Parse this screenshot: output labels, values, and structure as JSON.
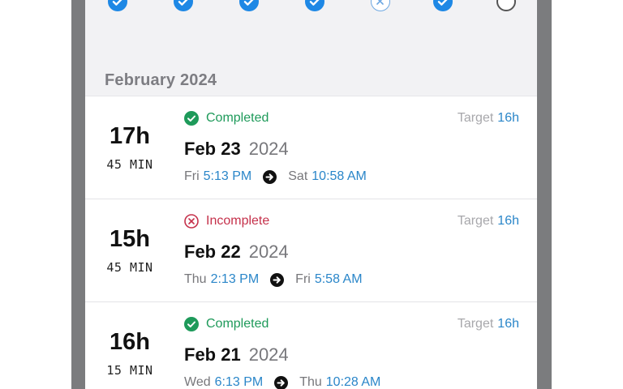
{
  "month_header": "February 2024",
  "week_days": [
    {
      "state": "done",
      "icon": "check-icon"
    },
    {
      "state": "done",
      "icon": "check-icon"
    },
    {
      "state": "done",
      "icon": "check-icon"
    },
    {
      "state": "done",
      "icon": "check-icon"
    },
    {
      "state": "failed",
      "icon": "x-circle-icon"
    },
    {
      "state": "done",
      "icon": "check-icon"
    },
    {
      "state": "pending",
      "icon": "empty-circle-icon"
    }
  ],
  "fasts": [
    {
      "hours": "17h",
      "minutes": "45 MIN",
      "status": "Completed",
      "status_icon": "check-circle-icon",
      "target_label": "Target",
      "target_value": "16h",
      "date": "Feb 23",
      "year": "2024",
      "start_day": "Fri",
      "start_time": "5:13 PM",
      "end_day": "Sat",
      "end_time": "10:58 AM"
    },
    {
      "hours": "15h",
      "minutes": "45 MIN",
      "status": "Incomplete",
      "status_icon": "x-circle-icon",
      "target_label": "Target",
      "target_value": "16h",
      "date": "Feb 22",
      "year": "2024",
      "start_day": "Thu",
      "start_time": "2:13 PM",
      "end_day": "Fri",
      "end_time": "5:58 AM"
    },
    {
      "hours": "16h",
      "minutes": "15 MIN",
      "status": "Completed",
      "status_icon": "check-circle-icon",
      "target_label": "Target",
      "target_value": "16h",
      "date": "Feb 21",
      "year": "2024",
      "start_day": "Wed",
      "start_time": "6:13 PM",
      "end_day": "Thu",
      "end_time": "10:28 AM"
    }
  ],
  "colors": {
    "completed": "#1e9a5a",
    "incomplete": "#c5314b",
    "accent": "#2a86c9",
    "day_done": "#1e88e5"
  }
}
